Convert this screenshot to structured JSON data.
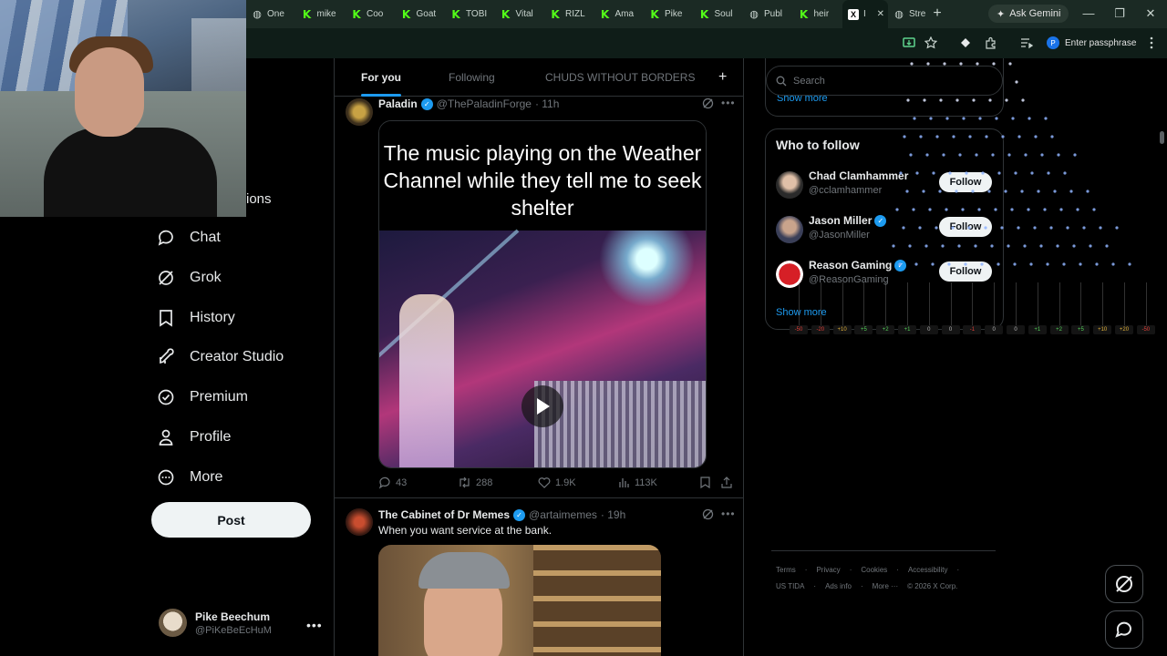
{
  "browser": {
    "tabs": [
      {
        "label": "One",
        "icon": "globe-icon"
      },
      {
        "label": "mike",
        "icon": "kick-icon"
      },
      {
        "label": "Coo",
        "icon": "kick-icon"
      },
      {
        "label": "Goat",
        "icon": "kick-icon"
      },
      {
        "label": "TOBI",
        "icon": "kick-icon"
      },
      {
        "label": "Vital",
        "icon": "kick-icon"
      },
      {
        "label": "RIZL",
        "icon": "kick-icon"
      },
      {
        "label": "Ama",
        "icon": "kick-icon"
      },
      {
        "label": "Pike",
        "icon": "kick-icon"
      },
      {
        "label": "Soul",
        "icon": "kick-icon"
      },
      {
        "label": "Publ",
        "icon": "globe-icon"
      },
      {
        "label": "heir",
        "icon": "kick-icon"
      }
    ],
    "active_tab": {
      "label": "I",
      "icon": "x-logo-icon"
    },
    "last_tab": {
      "label": "Stre",
      "icon": "globe-icon"
    },
    "gemini_label": "Ask Gemini",
    "passphrase_label": "Enter passphrase",
    "passphrase_avatar": "P",
    "accent": "#1b2a24"
  },
  "nav": {
    "partial_label": "ions",
    "items": [
      {
        "label": "Chat",
        "icon": "chat-icon"
      },
      {
        "label": "Grok",
        "icon": "grok-icon"
      },
      {
        "label": "History",
        "icon": "bookmark-icon"
      },
      {
        "label": "Creator Studio",
        "icon": "rocket-icon"
      },
      {
        "label": "Premium",
        "icon": "verified-icon"
      },
      {
        "label": "Profile",
        "icon": "person-icon"
      },
      {
        "label": "More",
        "icon": "more-circle-icon"
      }
    ],
    "post_label": "Post",
    "account": {
      "name": "Pike Beechum",
      "handle": "@PiKeBeEcHuM"
    }
  },
  "timeline": {
    "tabs": [
      {
        "label": "For you",
        "active": true
      },
      {
        "label": "Following",
        "active": false
      },
      {
        "label": "CHUDS WITHOUT BORDERS",
        "active": false
      }
    ],
    "posts": [
      {
        "name": "Paladin",
        "handle": "@ThePaladinForge",
        "time": "· 11h",
        "caption": "The music playing on the Weather Channel while they tell me to seek shelter",
        "replies": "43",
        "reposts": "288",
        "likes": "1.9K",
        "views": "113K"
      },
      {
        "name": "The Cabinet of Dr Memes",
        "handle": "@artaimemes",
        "time": "· 19h",
        "text": "When you want service at the bank."
      }
    ]
  },
  "right": {
    "search_placeholder": "Search",
    "prev_show_more": "Show more",
    "who_to_follow": {
      "title": "Who to follow",
      "users": [
        {
          "name": "Chad Clamhammer",
          "handle": "@cclamhammer",
          "verified": false,
          "follow_label": "Follow"
        },
        {
          "name": "Jason Miller",
          "handle": "@JasonMiller",
          "verified": true,
          "follow_label": "Follow"
        },
        {
          "name": "Reason Gaming",
          "handle": "@ReasonGaming",
          "verified": true,
          "follow_label": "Follow"
        }
      ],
      "show_more": "Show more"
    },
    "meter_labels": [
      "-50",
      "-20",
      "+10",
      "+5",
      "+2",
      "+1",
      "0",
      "0",
      "-1",
      "0",
      "0",
      "+1",
      "+2",
      "+5",
      "+10",
      "+20",
      "-50"
    ],
    "footer_row1": [
      "Terms",
      "·",
      "Privacy",
      "·",
      "Cookies",
      "·",
      "Accessibility",
      "·"
    ],
    "footer_row2": [
      "US TIDA",
      "·",
      "Ads info",
      "·",
      "More ···",
      "© 2026 X Corp."
    ]
  }
}
